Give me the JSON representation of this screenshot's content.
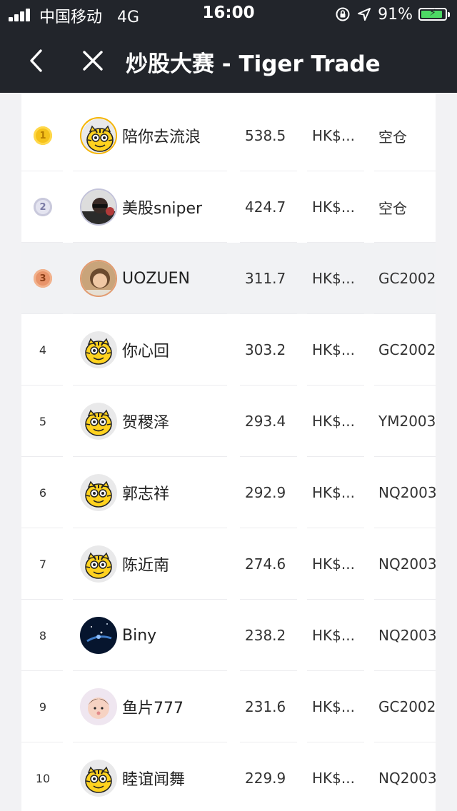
{
  "status_bar": {
    "carrier": "中国移动",
    "network": "4G",
    "time": "16:00",
    "battery": "91%",
    "battery_level": 0.91
  },
  "nav": {
    "title": "炒股大赛 - Tiger Trade"
  },
  "rows": [
    {
      "rank": "1",
      "medal": "gold",
      "name": "陪你去流浪",
      "value": "538.5",
      "currency": "HK$...",
      "position": "空仓",
      "avatar": "tiger"
    },
    {
      "rank": "2",
      "medal": "silver",
      "name": "美股sniper",
      "value": "424.7",
      "currency": "HK$...",
      "position": "空仓",
      "avatar": "photo-dark"
    },
    {
      "rank": "3",
      "medal": "bronze",
      "name": "UOZUEN",
      "value": "311.7",
      "currency": "HK$...",
      "position": "GC2002",
      "avatar": "photo-girl"
    },
    {
      "rank": "4",
      "name": "你心回",
      "value": "303.2",
      "currency": "HK$...",
      "position": "GC2002",
      "avatar": "tiger"
    },
    {
      "rank": "5",
      "name": "贺稷泽",
      "value": "293.4",
      "currency": "HK$...",
      "position": "YM2003",
      "avatar": "tiger"
    },
    {
      "rank": "6",
      "name": "郭志祥",
      "value": "292.9",
      "currency": "HK$...",
      "position": "NQ2003",
      "avatar": "tiger"
    },
    {
      "rank": "7",
      "name": "陈近南",
      "value": "274.6",
      "currency": "HK$...",
      "position": "NQ2003",
      "avatar": "tiger"
    },
    {
      "rank": "8",
      "name": "Biny",
      "value": "238.2",
      "currency": "HK$...",
      "position": "NQ2003",
      "avatar": "photo-space"
    },
    {
      "rank": "9",
      "name": "鱼片777",
      "value": "231.6",
      "currency": "HK$...",
      "position": "GC2002",
      "avatar": "photo-kid"
    },
    {
      "rank": "10",
      "name": "睦谊闻舞",
      "value": "229.9",
      "currency": "HK$...",
      "position": "NQ2003",
      "avatar": "tiger"
    }
  ]
}
